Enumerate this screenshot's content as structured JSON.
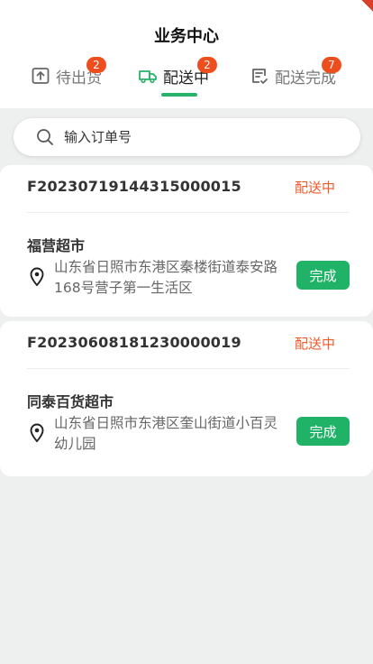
{
  "header": {
    "title": "业务中心"
  },
  "tabs": [
    {
      "label": "待出货",
      "badge": "2",
      "icon": "upload-box-icon"
    },
    {
      "label": "配送中",
      "badge": "2",
      "icon": "delivery-truck-icon",
      "active": true
    },
    {
      "label": "配送完成",
      "badge": "7",
      "icon": "checklist-icon"
    }
  ],
  "search": {
    "placeholder": "输入订单号",
    "icon": "search-icon"
  },
  "orders": [
    {
      "order_no": "F20230719144315000015",
      "status": "配送中",
      "shop": "福营超市",
      "address": "山东省日照市东港区秦楼街道泰安路168号营子第一生活区",
      "action": "完成"
    },
    {
      "order_no": "F20230608181230000019",
      "status": "配送中",
      "shop": "同泰百货超市",
      "address": "山东省日照市东港区奎山街道小百灵幼儿园",
      "action": "完成"
    }
  ],
  "colors": {
    "accent": "#27b36a",
    "badge": "#ee4d1e",
    "status": "#ee5a2a",
    "button": "#20b266"
  }
}
